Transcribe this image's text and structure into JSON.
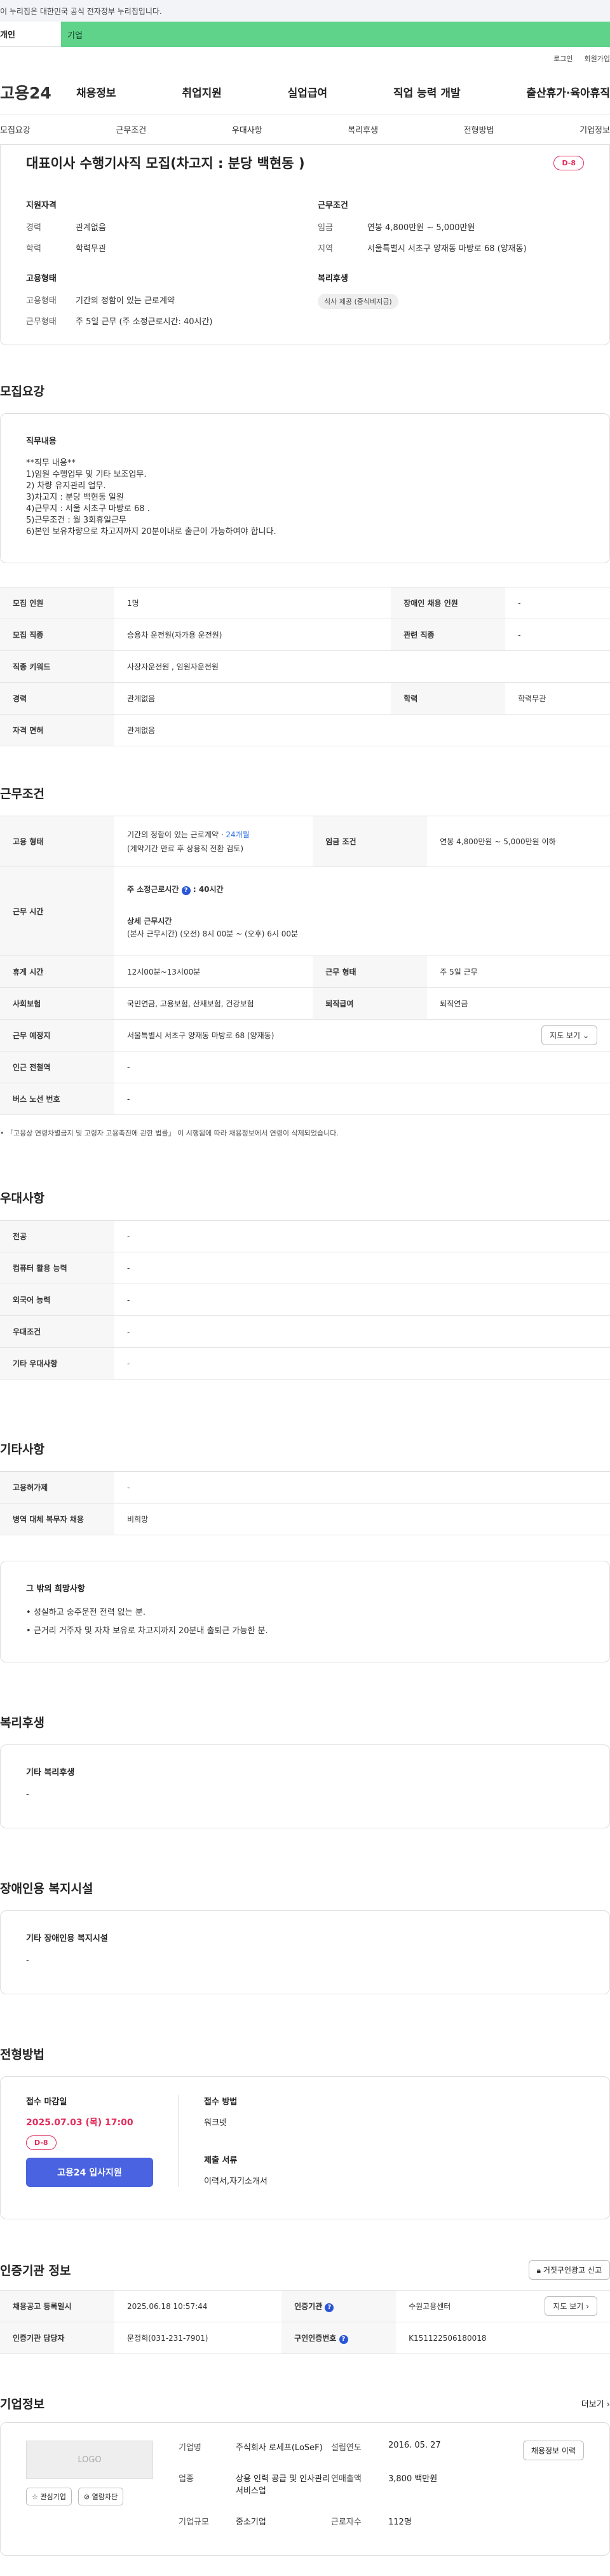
{
  "banner": {
    "text": "이 누리집은 대한민국 공식 전자정부 누리집입니다."
  },
  "site_tabs": {
    "personal": "개인",
    "company": "기업"
  },
  "util": {
    "login": "로그인",
    "signup": "회원가입"
  },
  "logo": "고용24",
  "gnb": [
    "채용정보",
    "취업지원",
    "실업급여",
    "직업 능력 개발",
    "출산휴가·육아휴직"
  ],
  "subnav": [
    "모집요강",
    "근무조건",
    "우대사항",
    "복리후생",
    "전형방법",
    "기업정보"
  ],
  "job": {
    "title": "대표이사 수행기사직 모집(차고지 : 분당 백현동 )",
    "dday": "D-8",
    "qual_heading": "지원자격",
    "qual": [
      {
        "k": "경력",
        "v": "관계없음"
      },
      {
        "k": "학력",
        "v": "학력무관"
      }
    ],
    "work_heading": "근무조건",
    "work": [
      {
        "k": "임금",
        "v": "연봉 4,800만원 ~ 5,000만원"
      },
      {
        "k": "지역",
        "v": "서울특별시 서초구 양재동 마방로 68 (양재동)"
      }
    ],
    "emp_heading": "고용형태",
    "emp": [
      {
        "k": "고용형태",
        "v": "기간의 정함이 있는 근로계약"
      },
      {
        "k": "근무형태",
        "v": "주 5일 근무 (주 소정근로시간: 40시간)"
      }
    ],
    "welfare_heading": "복리후생",
    "welfare_chip": "식사 제공 (중식비지급)"
  },
  "recruit": {
    "title": "모집요강",
    "duty_heading": "직무내용",
    "duty_lines": [
      "**직무 내용**",
      "1)임원 수행업무  및 기타 보조업무.",
      "2) 차량 유지관리 업무.",
      "3)차고지 : 분당 백현동 일원",
      "4)근무지 : 서울 서초구  마방로 68 .",
      "5)근무조건 : 월 3회휴일근무",
      "6)본인 보유차량으로 차고지까지 20분이내로 출근이 가능하여야 합니다."
    ],
    "table": {
      "r1": [
        "모집 인원",
        "1명",
        "장애인 채용 인원",
        "-"
      ],
      "r2": [
        "모집 직종",
        "승용차 운전원(자가용 운전원)",
        "관련 직종",
        "-"
      ],
      "r3": [
        "직종 키워드",
        "사장자운전원 , 임원자운전원"
      ],
      "r4": [
        "경력",
        "관계없음",
        "학력",
        "학력무관"
      ],
      "r5": [
        "자격 면허",
        "관계없음"
      ]
    }
  },
  "conditions": {
    "title": "근무조건",
    "employ_type_k": "고용 형태",
    "employ_type_v1": "기간의 정함이 있는 근로계약 · ",
    "employ_type_months": "24개월",
    "employ_type_v2": "(계약기간 만료 후 상용직 전환 검토)",
    "wage_k": "임금 조건",
    "wage_v": "연봉 4,800만원 ~ 5,000만원 이하",
    "hours_k": "근무 시간",
    "hours_weekly_label": "주 소정근로시간",
    "hours_weekly_value": ": 40시간",
    "hours_detail_label": "상세 근무시간",
    "hours_detail_value": "(본사 근무시간)  (오전) 8시 00분 ~ (오후) 6시 00분",
    "break_k": "휴게 시간",
    "break_v": "12시00분~13시00분",
    "worktype_k": "근무 형태",
    "worktype_v": "주 5일 근무",
    "insurance_k": "사회보험",
    "insurance_v": "국민연금, 고용보험, 산재보험, 건강보험",
    "retire_k": "퇴직급여",
    "retire_v": "퇴직연금",
    "place_k": "근무 예정지",
    "place_v": "서울특별시 서초구 양재동 마방로 68 (양재동)",
    "map_btn": "지도 보기",
    "subway_k": "인근 전철역",
    "subway_v": "-",
    "bus_k": "버스 노선 번호",
    "bus_v": "-",
    "note": "「고용상 연령차별금지 및 고령자 고용촉진에 관한 법률」 이 시행됨에 따라 채용정보에서 연령이 삭제되었습니다."
  },
  "preference": {
    "title": "우대사항",
    "rows": [
      [
        "전공",
        "-"
      ],
      [
        "컴퓨터 활용 능력",
        "-"
      ],
      [
        "외국어 능력",
        "-"
      ],
      [
        "우대조건",
        "-"
      ],
      [
        "기타 우대사항",
        "-"
      ]
    ]
  },
  "etc": {
    "title": "기타사항",
    "rows": [
      [
        "고용허가제",
        "-"
      ],
      [
        "병역 대체 복무자 채용",
        "비희망"
      ]
    ],
    "other_heading": "그 밖의 희망사항",
    "other_items": [
      "성실하고 숭주운전 전력 없는 분.",
      "근거리 거주자 및 자차 보유로 차고지까지 20분내 출퇴근 가능한 분."
    ]
  },
  "welfare": {
    "title": "복리후생",
    "heading": "기타 복리후생",
    "value": "-"
  },
  "disability": {
    "title": "장애인용 복지시설",
    "heading": "기타 장애인용 복지시설",
    "value": "-"
  },
  "screening": {
    "title": "전형방법",
    "deadline_label": "접수 마감일",
    "deadline": "2025.07.03 (목) 17:00",
    "dday": "D-8",
    "apply_btn": "고용24 입사지원",
    "method_label": "접수 방법",
    "method": "워크넷",
    "docs_label": "제출 서류",
    "docs": "이력서,자기소개서"
  },
  "cert": {
    "title": "인증기관 정보",
    "report_btn": "거짓구인광고 신고",
    "r1": [
      "채용공고 등록일시",
      "2025.06.18 10:57:44",
      "인증기관",
      "수원고용센터"
    ],
    "map_btn": "지도 보기",
    "r2": [
      "인증기관 담당자",
      "문정희(031-231-7901)",
      "구인인증번호",
      "K151122506180018"
    ]
  },
  "company": {
    "title": "기업정보",
    "more": "더보기",
    "logo": "LOGO",
    "interest_btn": "관심기업",
    "block_btn": "열람차단",
    "name_k": "기업명",
    "name_v": "주식회사 로세프(LoSeF)",
    "biz_k": "업종",
    "biz_v": "상용 인력 공급 및 인사관리 서비스업",
    "scale_k": "기업규모",
    "scale_v": "중소기업",
    "founded_k": "설립연도",
    "founded_v": "2016. 05. 27",
    "sales_k": "연매출액",
    "sales_v": "3,800 백만원",
    "staff_k": "근로자수",
    "staff_v": "112명",
    "jobs_btn": "채용정보 이력"
  }
}
